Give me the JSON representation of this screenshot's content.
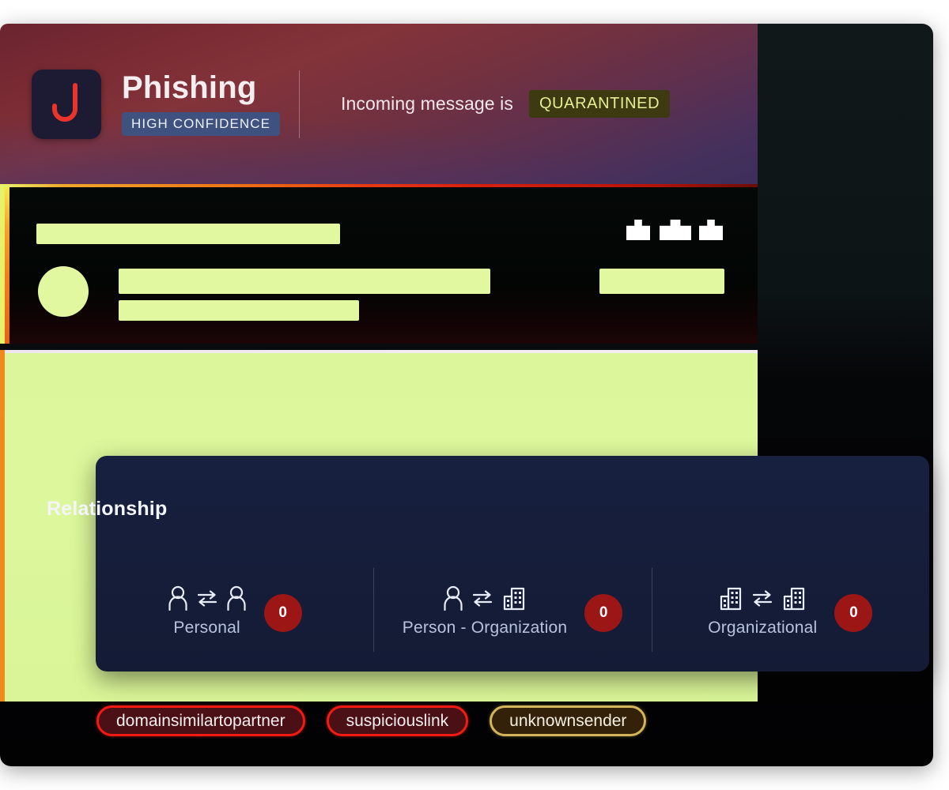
{
  "header": {
    "logo_icon": "fishing-hook-icon",
    "logo_letter": "J",
    "threat_type": "Phishing",
    "confidence_badge": "HIGH CONFIDENCE",
    "status_prefix": "Incoming message is",
    "status_badge": "QUARANTINED",
    "accent_red": "#f21b14",
    "badge_blue": "#3e517f",
    "badge_olive_bg": "#3d3a11",
    "badge_olive_text": "#e4ef95"
  },
  "message_card": {
    "redacted": true,
    "action_icons": [
      "action-glyph-1",
      "action-glyph-2",
      "action-glyph-3"
    ],
    "accent_border": "#ef8a1f"
  },
  "body_block": {
    "redacted": true,
    "fill": "#dcf79b"
  },
  "relationship": {
    "title": "Relationship",
    "items": [
      {
        "label": "Personal",
        "count": "0",
        "left_icon": "person-icon",
        "exchange_icon": "exchange-arrows-icon",
        "right_icon": "person-icon"
      },
      {
        "label": "Person - Organization",
        "count": "0",
        "left_icon": "person-icon",
        "exchange_icon": "exchange-arrows-icon",
        "right_icon": "building-icon"
      },
      {
        "label": "Organizational",
        "count": "0",
        "left_icon": "building-icon",
        "exchange_icon": "exchange-arrows-icon",
        "right_icon": "building-icon"
      }
    ],
    "count_badge_color": "#9c1616"
  },
  "tags": [
    {
      "label": "domainsimilartopartner",
      "severity": "danger"
    },
    {
      "label": "suspiciouslink",
      "severity": "danger"
    },
    {
      "label": "unknownsender",
      "severity": "warn"
    }
  ]
}
